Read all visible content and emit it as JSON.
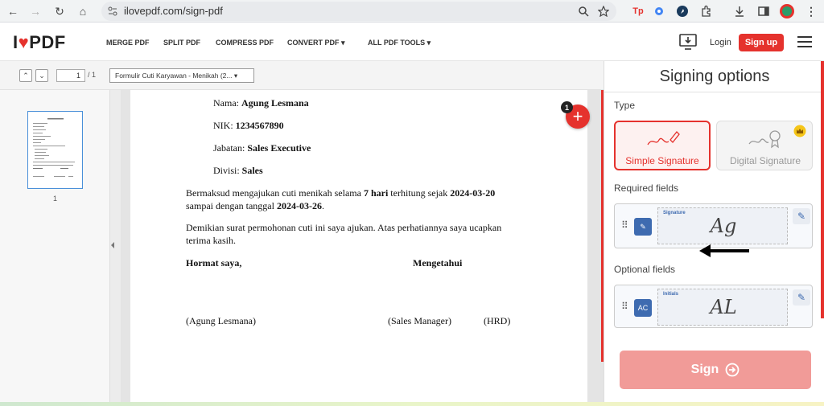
{
  "browser": {
    "url": "ilovepdf.com/sign-pdf",
    "back_icon": "←",
    "forward_icon": "→",
    "reload_icon": "↻",
    "home_icon": "⌂",
    "ext_tp": "Tp"
  },
  "header": {
    "logo_i": "I",
    "logo_heart": "♥",
    "logo_pdf": "PDF",
    "nav": [
      "MERGE PDF",
      "SPLIT PDF",
      "COMPRESS PDF",
      "CONVERT PDF ▾",
      "ALL PDF TOOLS ▾"
    ],
    "login": "Login",
    "signup": "Sign up",
    "accent": "#e5322d"
  },
  "toolbar": {
    "page_current": "1",
    "page_total": "/ 1",
    "document": "Formulir Cuti Karyawan - Menikah (2... ▾"
  },
  "thumbnails": {
    "page_number": "1"
  },
  "document": {
    "line_nama_label": "Nama: ",
    "line_nama_value": "Agung Lesmana",
    "line_nik_label": "NIK: ",
    "line_nik_value": "1234567890",
    "line_jabatan_label": "Jabatan: ",
    "line_jabatan_value": "Sales Executive",
    "line_divisi_label": "Divisi: ",
    "line_divisi_value": "Sales",
    "para1_a": "Bermaksud mengajukan cuti menikah selama ",
    "para1_b": "7 hari",
    "para1_c": " terhitung sejak ",
    "para1_d": "2024-03-20",
    "para1_e": "sampai dengan tanggal ",
    "para1_f": "2024-03-26",
    "para1_g": ".",
    "para2_a": "Demikian surat permohonan cuti ini saya ajukan. Atas perhatiannya saya ucapkan",
    "para2_b": "terima kasih.",
    "hormat": "Hormat saya,",
    "mengetahui": "Mengetahui",
    "sig_left": "(Agung Lesmana)",
    "sig_mid": "(Sales Manager)",
    "sig_right": "(HRD)"
  },
  "add_field": {
    "badge": "1",
    "icon": "+"
  },
  "signing": {
    "title": "Signing options",
    "type_label": "Type",
    "simple": "Simple Signature",
    "digital": "Digital Signature",
    "required_label": "Required fields",
    "required_field": {
      "name": "Signature",
      "preview": "Ag",
      "icon": "✎"
    },
    "optional_label": "Optional fields",
    "optional_field": {
      "name": "Initials",
      "preview": "AL",
      "icon": "AC"
    },
    "sign_button": "Sign",
    "sign_icon": "➔"
  }
}
